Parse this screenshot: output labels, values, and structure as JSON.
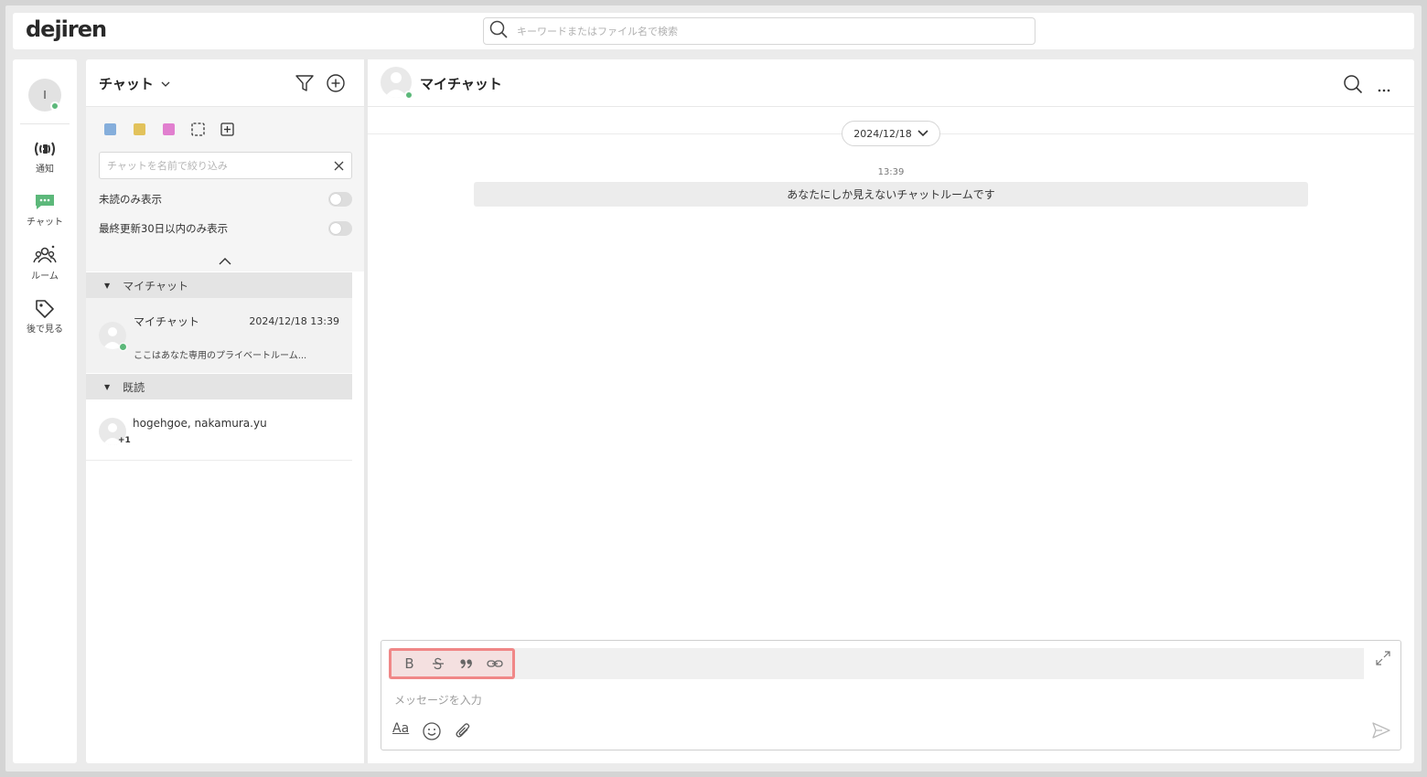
{
  "app": {
    "logo": "dejiren"
  },
  "search": {
    "placeholder": "キーワードまたはファイル名で検索"
  },
  "user": {
    "initial": "I"
  },
  "rail": {
    "items": [
      {
        "label": "通知",
        "icon": "broadcast-icon"
      },
      {
        "label": "チャット",
        "icon": "chat-bubble-icon"
      },
      {
        "label": "ルーム",
        "icon": "people-icon"
      },
      {
        "label": "後で見る",
        "icon": "tag-icon"
      }
    ]
  },
  "list": {
    "title": "チャット",
    "color_filters": [
      "#85aedb",
      "#e2c25b",
      "#e17fcf"
    ],
    "filter_placeholder": "チャットを名前で絞り込み",
    "unread_only_label": "未読のみ表示",
    "recent_only_label": "最終更新30日以内のみ表示",
    "sections": [
      {
        "label": "マイチャット",
        "items": [
          {
            "name": "マイチャット",
            "date": "2024/12/18 13:39",
            "preview": "ここはあなた専用のプライベートルーム..."
          }
        ]
      },
      {
        "label": "既読",
        "items": [
          {
            "name": "hogehgoe, nakamura.yu",
            "badge": "+1"
          }
        ]
      }
    ]
  },
  "main": {
    "title": "マイチャット",
    "date_pill": "2024/12/18",
    "message_time": "13:39",
    "system_message": "あなたにしか見えないチャットルームです"
  },
  "composer": {
    "placeholder": "メッセージを入力",
    "format_buttons": [
      "B",
      "strikethrough-icon",
      "quote-icon",
      "link-icon"
    ],
    "text_format_label": "Aa"
  },
  "colors": {
    "online": "#5cb87a",
    "chat_green": "#5cb87a",
    "highlight": "#f08787"
  }
}
